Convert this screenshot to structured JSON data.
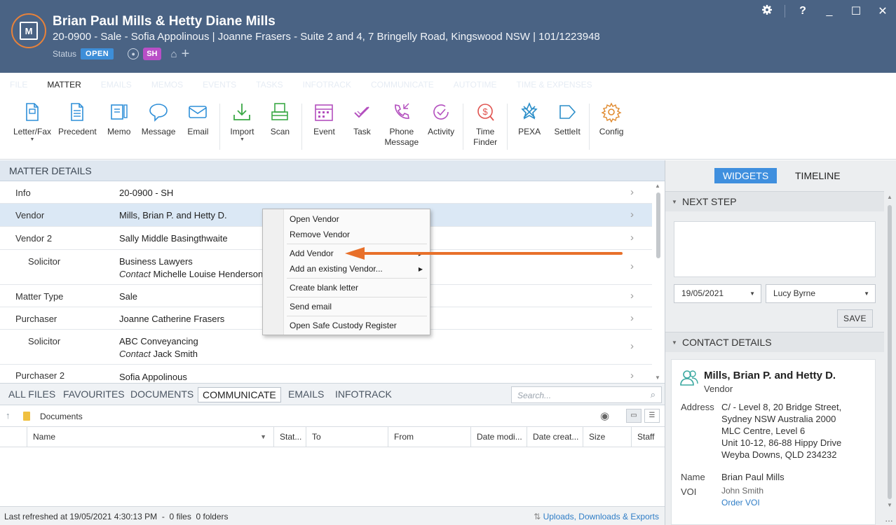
{
  "header": {
    "title": "Brian Paul Mills & Hetty Diane Mills",
    "subtitle": "20-0900 - Sale - Sofia Appolinous | Joanne Frasers - Suite 2 and 4, 7 Bringelly Road, Kingswood NSW | 101/1223948",
    "status_label": "Status",
    "status_value": "OPEN",
    "staff_initials": "SH",
    "window_controls": [
      "gear-icon",
      "help-icon",
      "minimize-icon",
      "maximize-icon",
      "close-icon"
    ],
    "help_glyph": "?"
  },
  "tabs": [
    "FILE",
    "MATTER",
    "EMAILS",
    "MEMOS",
    "EVENTS",
    "TASKS",
    "INFOTRACK",
    "COMMUNICATE",
    "AUTOTIME",
    "TIME & EXPENSES"
  ],
  "ribbon": {
    "letter_fax": "Letter/Fax",
    "precedent": "Precedent",
    "memo": "Memo",
    "message": "Message",
    "email": "Email",
    "import": "Import",
    "scan": "Scan",
    "event": "Event",
    "task": "Task",
    "phone_message_1": "Phone",
    "phone_message_2": "Message",
    "activity": "Activity",
    "time_finder_1": "Time",
    "time_finder_2": "Finder",
    "pexa": "PEXA",
    "settleit": "SettleIt",
    "config": "Config"
  },
  "matter_details": {
    "heading": "MATTER DETAILS",
    "rows": [
      {
        "label": "Info",
        "value": "20-0900 - SH"
      },
      {
        "label": "Vendor",
        "value": "Mills, Brian P. and Hetty D."
      },
      {
        "label": "Vendor 2",
        "value": "Sally Middle Basingthwaite"
      },
      {
        "label": "Solicitor",
        "value": "Business Lawyers",
        "contact_label": "Contact",
        "contact_value": "Michelle Louise Henderson"
      },
      {
        "label": "Matter Type",
        "value": "Sale"
      },
      {
        "label": "Purchaser",
        "value": "Joanne Catherine Frasers"
      },
      {
        "label": "Solicitor",
        "value": "ABC Conveyancing",
        "contact_label": "Contact",
        "contact_value": "Jack Smith"
      },
      {
        "label": "Purchaser 2",
        "value": "Sofia Appolinous"
      }
    ]
  },
  "context_menu": {
    "items": [
      "Open Vendor",
      "Remove Vendor",
      "Add Vendor",
      "Add an existing Vendor...",
      "Create blank letter",
      "Send email",
      "Open Safe Custody Register"
    ]
  },
  "files": {
    "tabs": [
      "ALL FILES",
      "FAVOURITES",
      "DOCUMENTS",
      "COMMUNICATE",
      "EMAILS",
      "INFOTRACK"
    ],
    "search_placeholder": "Search...",
    "breadcrumb": "Documents",
    "columns": [
      "Name",
      "Stat...",
      "To",
      "From",
      "Date modi...",
      "Date creat...",
      "Size",
      "Staff"
    ],
    "status_left": "Last refreshed at 19/05/2021 4:30:13 PM  -  0 files  0 folders",
    "status_right": "Uploads, Downloads & Exports"
  },
  "right_panel": {
    "tab_widgets": "WIDGETS",
    "tab_timeline": "TIMELINE",
    "next_step_heading": "NEXT STEP",
    "date_value": "19/05/2021",
    "staff_value": "Lucy Byrne",
    "save_label": "SAVE",
    "contact_heading": "CONTACT DETAILS",
    "contact_name": "Mills, Brian P. and Hetty D.",
    "contact_role": "Vendor",
    "address_label": "Address",
    "address_lines": [
      "C/ - Level 8, 20 Bridge Street,",
      "Sydney NSW Australia 2000",
      "MLC Centre, Level 6",
      "Unit 10-12, 86-88 Hippy Drive",
      "Weyba Downs, QLD 234232"
    ],
    "name_label": "Name",
    "name_value": "Brian Paul Mills",
    "voi_label": "VOI",
    "voi_value": "John Smith",
    "voi_link": "Order VOI"
  }
}
